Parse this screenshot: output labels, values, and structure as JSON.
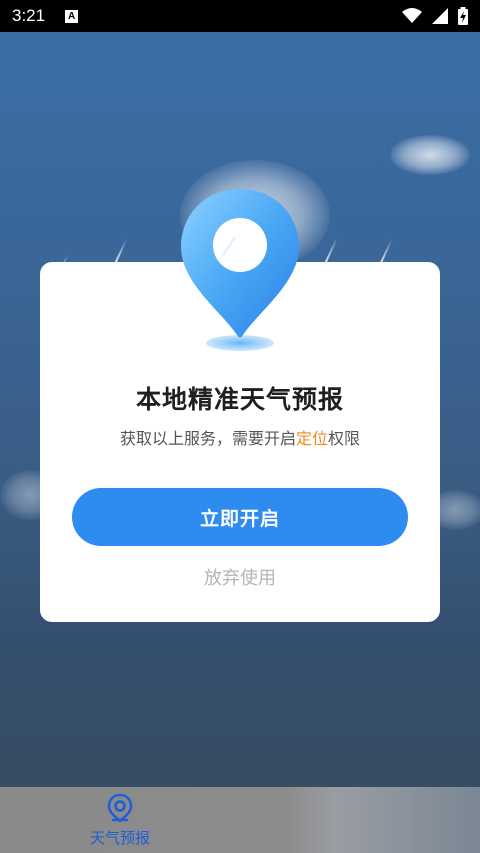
{
  "status_bar": {
    "time": "3:21",
    "notification_icon_letter": "A",
    "icons": [
      "wifi-icon",
      "signal-icon",
      "battery-charging-icon"
    ]
  },
  "dialog": {
    "title": "本地精准天气预报",
    "subtitle_before": "获取以上服务，需要开启",
    "subtitle_highlight": "定位",
    "subtitle_after": "权限",
    "primary_button": "立即开启",
    "dismiss_link": "放弃使用",
    "illustration": "location-pin-icon"
  },
  "bottom_nav": {
    "items": [
      {
        "label": "天气预报",
        "icon": "location-pin-icon",
        "active": true
      }
    ]
  },
  "colors": {
    "accent": "#2e8bf0",
    "highlight": "#f08a1c",
    "nav_active": "#1d5fd6",
    "dismiss_text": "#b5b5b5"
  }
}
